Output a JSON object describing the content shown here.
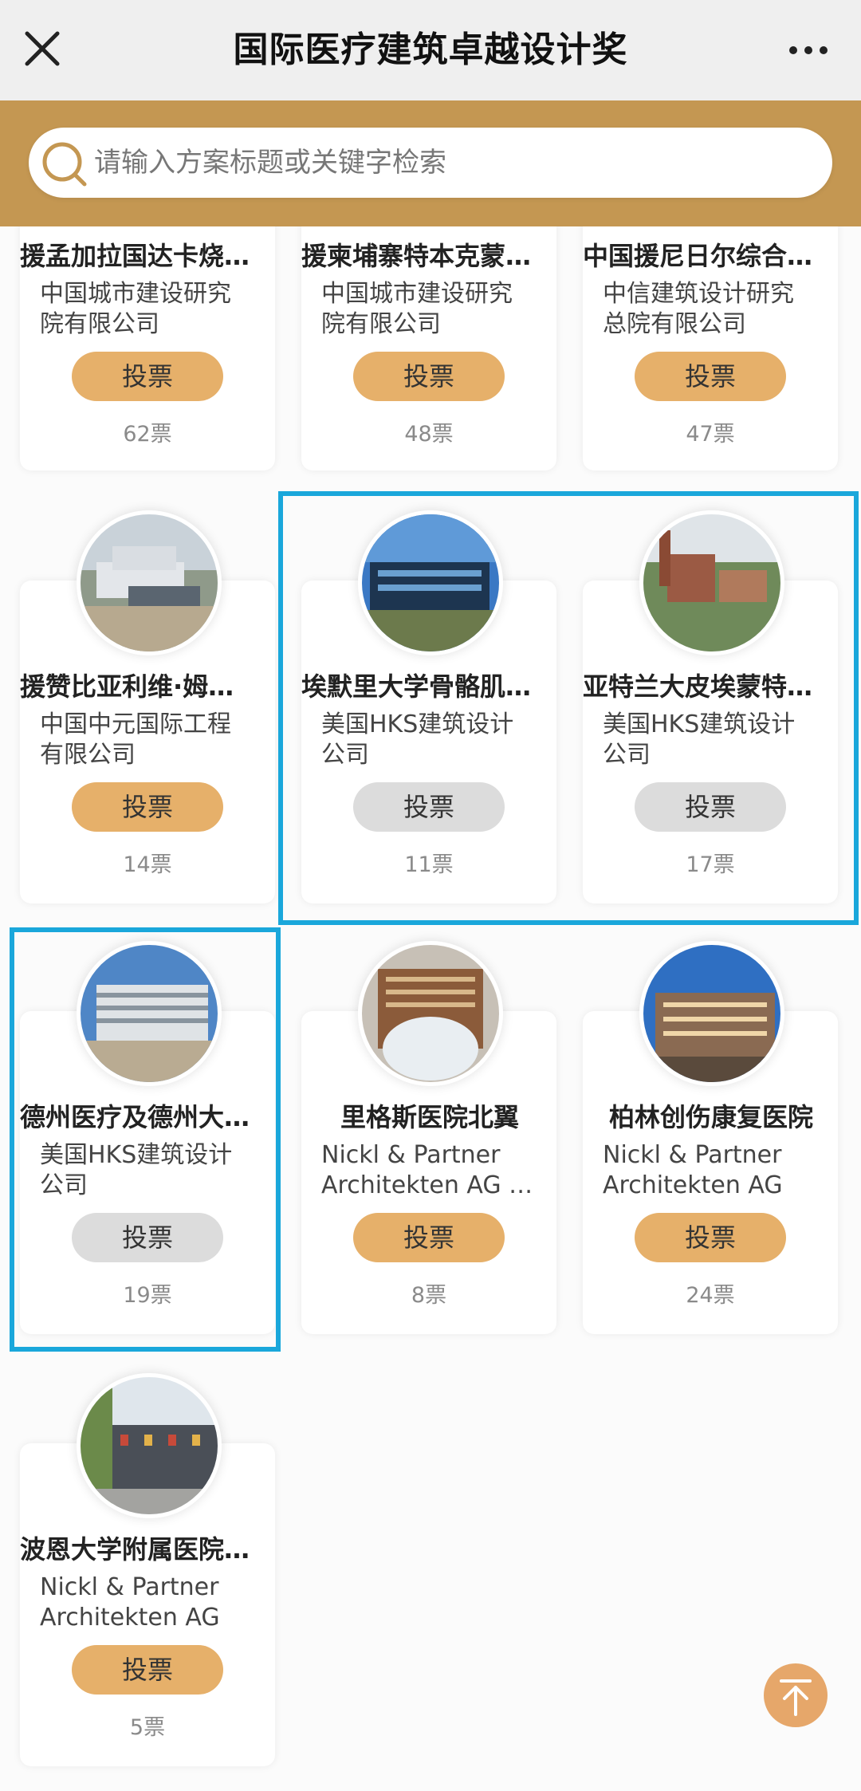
{
  "header": {
    "title": "国际医疗建筑卓越设计奖"
  },
  "search": {
    "placeholder": "请输入方案标题或关键字检索"
  },
  "colors": {
    "gold": "#c49752",
    "vote_gold": "#e6b06a",
    "vote_grey": "#dcdcdc",
    "highlight": "#1aa7db"
  },
  "icons": {
    "close": "close-icon",
    "more": "more-icon",
    "search": "search-icon",
    "back_to_top": "arrow-up-icon"
  },
  "vote_label": "投票",
  "cards": [
    {
      "title": "援孟加拉国达卡烧…",
      "org": [
        "中国城市建设研究",
        "院有限公司"
      ],
      "votes": "62票",
      "vote_state": "active"
    },
    {
      "title": "援柬埔寨特本克蒙…",
      "org": [
        "中国城市建设研究",
        "院有限公司"
      ],
      "votes": "48票",
      "vote_state": "active"
    },
    {
      "title": "中国援尼日尔综合…",
      "org": [
        "中信建筑设计研究",
        "总院有限公司"
      ],
      "votes": "47票",
      "vote_state": "active"
    },
    {
      "title": "援赞比亚利维·姆…",
      "org": [
        "中国中元国际工程",
        "有限公司"
      ],
      "votes": "14票",
      "vote_state": "active"
    },
    {
      "title": "埃默里大学骨骼肌…",
      "org": [
        "美国HKS建筑设计",
        "公司"
      ],
      "votes": "11票",
      "vote_state": "voted"
    },
    {
      "title": "亚特兰大皮埃蒙特…",
      "org": [
        "美国HKS建筑设计",
        "公司"
      ],
      "votes": "17票",
      "vote_state": "voted"
    },
    {
      "title": "德州医疗及德州大…",
      "org": [
        "美国HKS建筑设计",
        "公司"
      ],
      "votes": "19票",
      "vote_state": "voted"
    },
    {
      "title": "里格斯医院北翼",
      "org": [
        "Nickl & Partner",
        "Architekten AG …"
      ],
      "votes": "8票",
      "vote_state": "active"
    },
    {
      "title": "柏林创伤康复医院",
      "org": [
        "Nickl & Partner",
        "Architekten AG"
      ],
      "votes": "24票",
      "vote_state": "active"
    },
    {
      "title": "波恩大学附属医院…",
      "org": [
        "Nickl & Partner",
        "Architekten AG"
      ],
      "votes": "5票",
      "vote_state": "active"
    }
  ]
}
